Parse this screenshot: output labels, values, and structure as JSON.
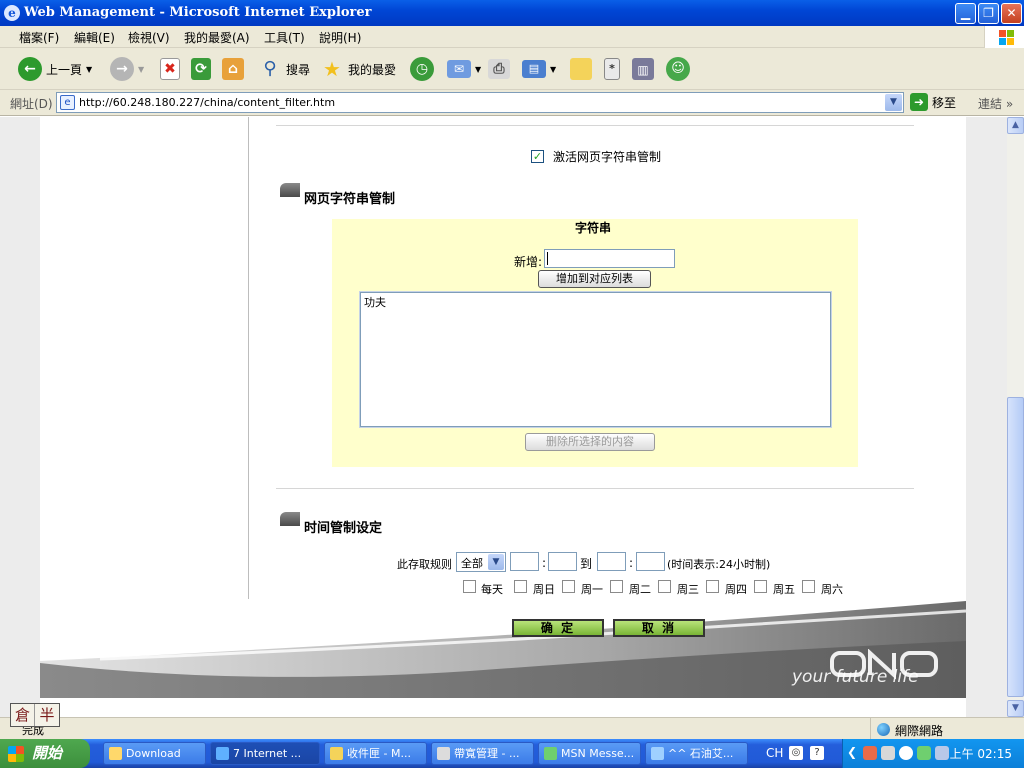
{
  "window": {
    "title": "Web Management - Microsoft Internet Explorer"
  },
  "menu": [
    "檔案(F)",
    "編輯(E)",
    "檢視(V)",
    "我的最愛(A)",
    "工具(T)",
    "說明(H)"
  ],
  "toolbar": {
    "back": "上一頁",
    "search": "搜尋",
    "favorites": "我的最愛"
  },
  "address": {
    "label": "網址(D)",
    "url": "http://60.248.180.227/china/content_filter.htm",
    "go": "移至",
    "links": "連結"
  },
  "page": {
    "activate_label": "激活网页字符串管制",
    "activate_checked": true,
    "section1_title": "网页字符串管制",
    "panel_title": "字符串",
    "new_label": "新增:",
    "add_button": "增加到对应列表",
    "list_items": [
      "功夫"
    ],
    "delete_button": "删除所选择的内容",
    "section2_title": "时间管制设定",
    "rule_label": "此存取规则",
    "rule_option": "全部",
    "to_label": "到",
    "colon": ":",
    "time_note": "(时间表示:24小时制)",
    "days": [
      "每天",
      "周日",
      "周一",
      "周二",
      "周三",
      "周四",
      "周五",
      "周六"
    ],
    "ok_button": "确 定",
    "cancel_button": "取 消",
    "brand": "your future life"
  },
  "status": {
    "text": "完成",
    "zone": "網際網路"
  },
  "ime": [
    "倉",
    "半"
  ],
  "taskbar": {
    "start": "開始",
    "tasks": [
      "Download",
      "7 Internet ...",
      "收件匣 - M...",
      "帶寬管理 - ...",
      "MSN Messe...",
      "^^ 石油艾..."
    ],
    "lang": "CH",
    "clock": "上午 02:15"
  },
  "colors": {
    "titlebar": "#0046d5",
    "panel": "#ffffcc",
    "ok_green": "#7ab536",
    "taskbar": "#245edb"
  }
}
